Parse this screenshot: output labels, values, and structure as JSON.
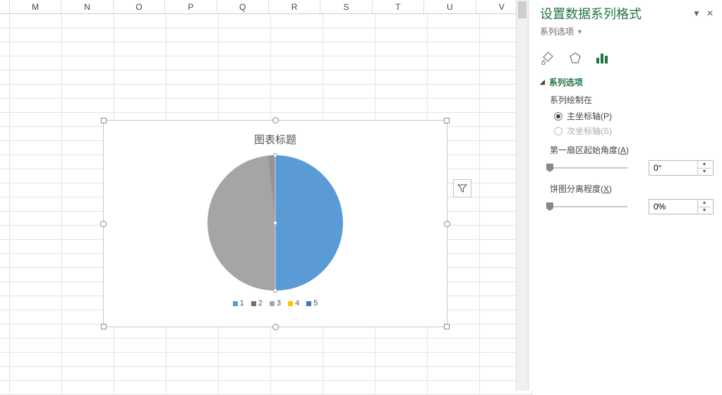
{
  "columns": [
    "M",
    "N",
    "O",
    "P",
    "Q",
    "R",
    "S",
    "T",
    "U",
    "V"
  ],
  "chart": {
    "title": "图表标题",
    "legend": [
      {
        "label": "1",
        "color": "#5b9bd5"
      },
      {
        "label": "2",
        "color": "#707070"
      },
      {
        "label": "3",
        "color": "#a5a5a5"
      },
      {
        "label": "4",
        "color": "#ffc000"
      },
      {
        "label": "5",
        "color": "#4472c4"
      }
    ]
  },
  "chart_data": {
    "type": "pie",
    "title": "图表标题",
    "series_name": "",
    "categories": [
      "1",
      "2",
      "3",
      "4",
      "5"
    ],
    "values": [
      50,
      1,
      49,
      0,
      0
    ],
    "colors": [
      "#5b9bd5",
      "#707070",
      "#a5a5a5",
      "#ffc000",
      "#4472c4"
    ],
    "note": "slice percentages estimated from rendered angles"
  },
  "panel": {
    "title": "设置数据系列格式",
    "dropdown": "系列选项",
    "section": "系列选项",
    "plot_on_label": "系列绘制在",
    "primary_axis": "主坐标轴(P)",
    "secondary_axis": "次坐标轴(S)",
    "angle_label_pre": "第一扇区起始角度(",
    "angle_key": "A",
    "angle_label_post": ")",
    "angle_value": "0°",
    "explode_label_pre": "饼图分离程度(",
    "explode_key": "X",
    "explode_label_post": ")",
    "explode_value": "0%"
  }
}
